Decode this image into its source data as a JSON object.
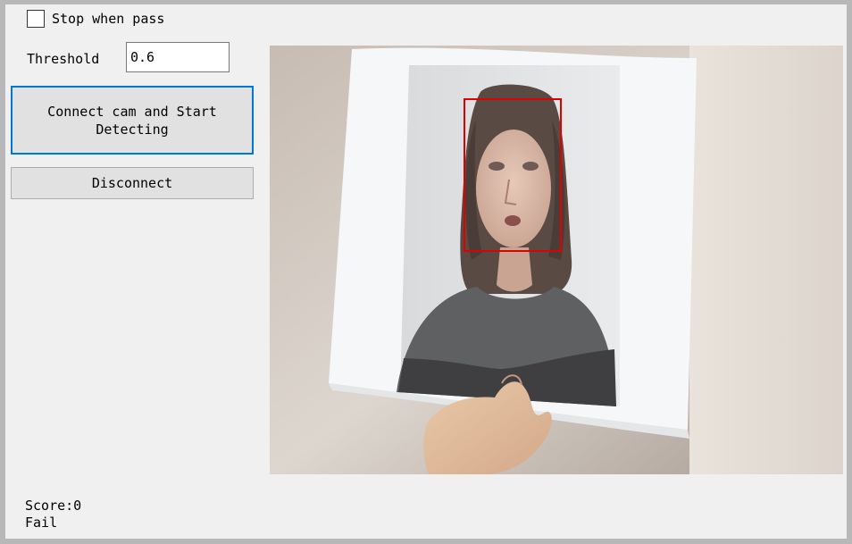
{
  "controls": {
    "stop_when_pass_label": "Stop when pass",
    "stop_when_pass_checked": false,
    "threshold_label": "Threshold",
    "threshold_value": "0.6"
  },
  "buttons": {
    "connect_label": "Connect cam and Start Detecting",
    "disconnect_label": "Disconnect"
  },
  "camera": {
    "face_box_color": "#e00000"
  },
  "status": {
    "score_text": "Score:0",
    "result_text": "Fail"
  }
}
